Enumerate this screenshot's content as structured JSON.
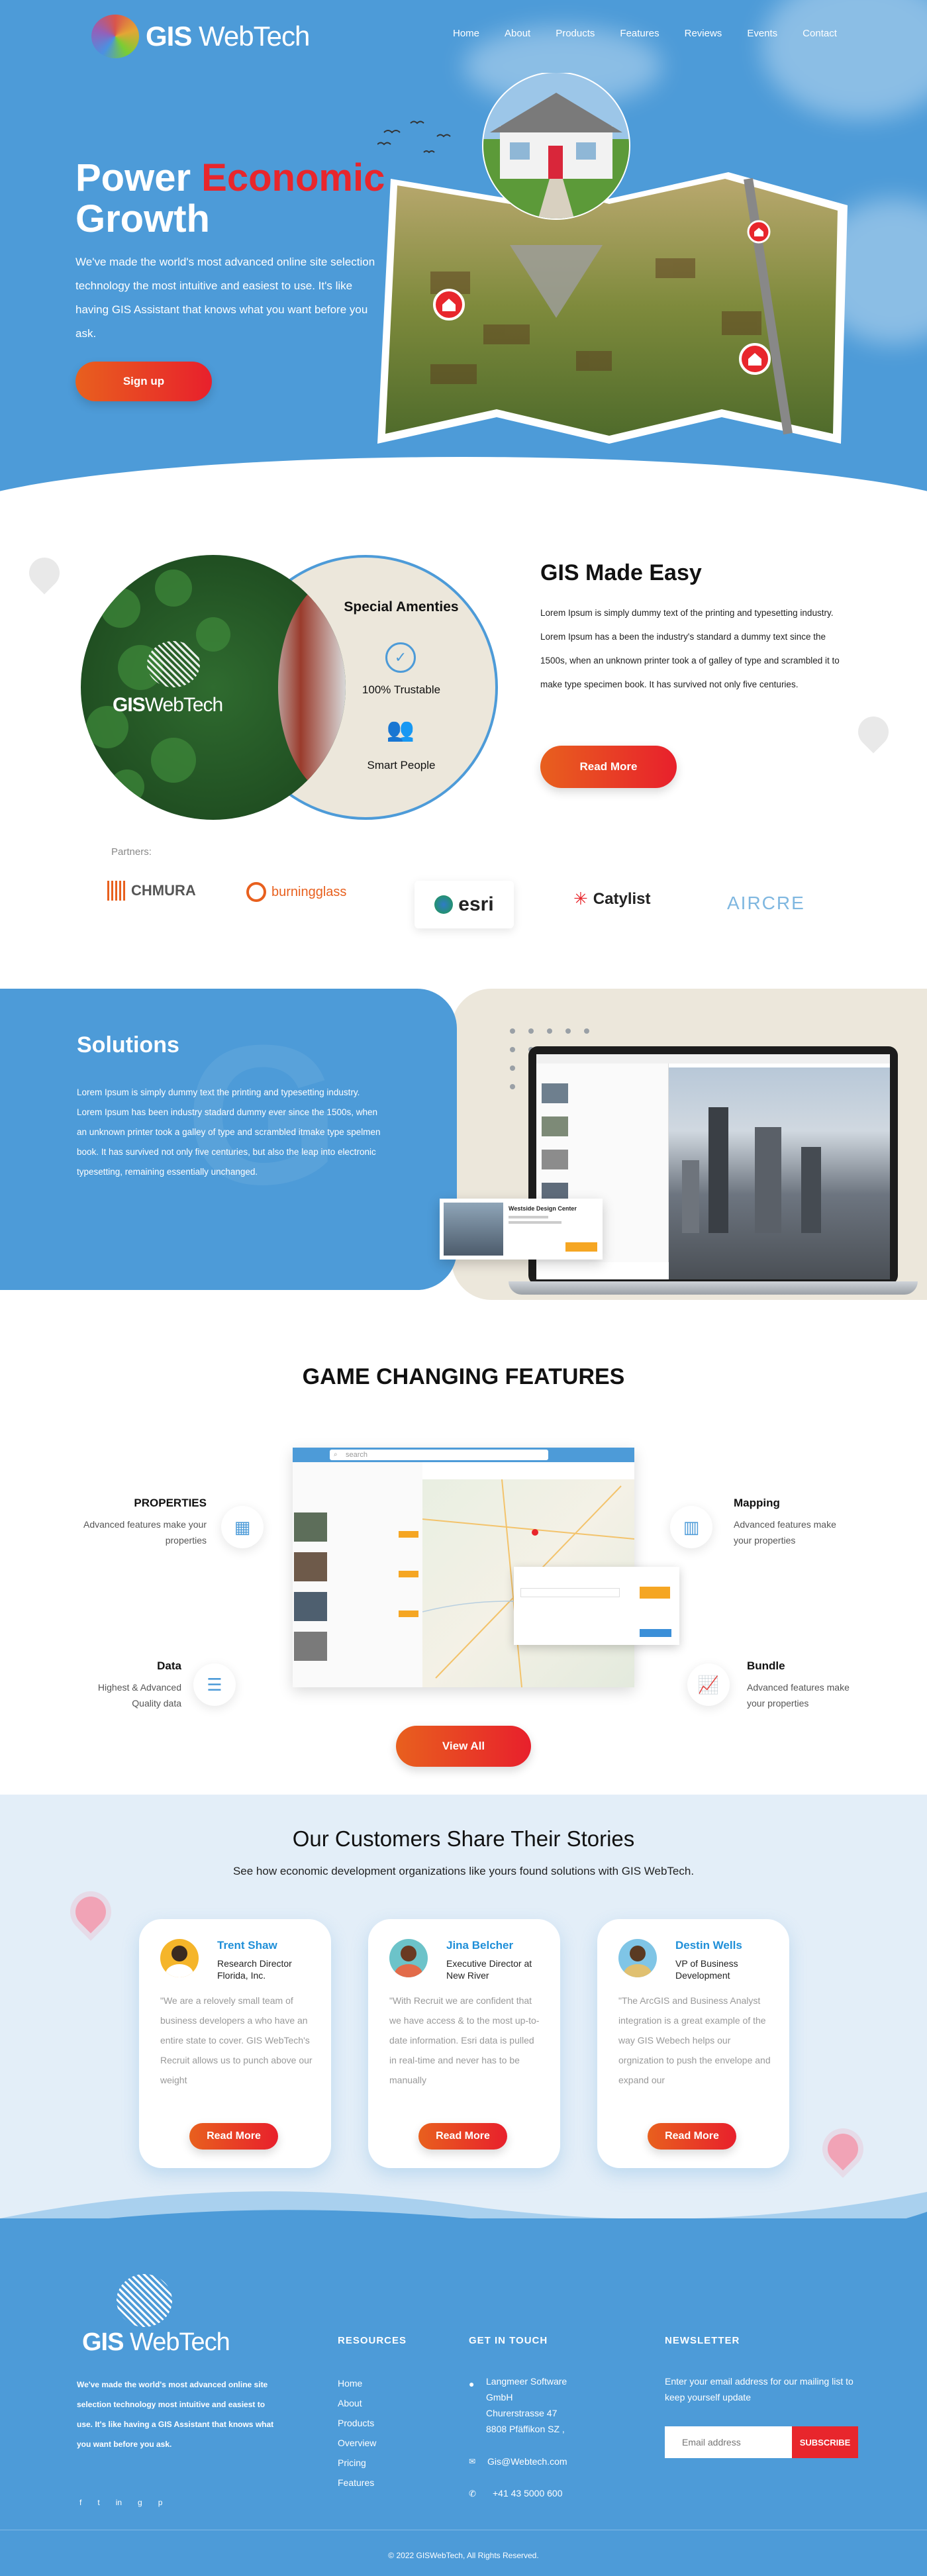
{
  "brand": {
    "name_bold": "GIS",
    "name_light": " WebTech"
  },
  "nav": [
    "Home",
    "About",
    "Products",
    "Features",
    "Reviews",
    "Events",
    "Contact"
  ],
  "hero": {
    "title_1": "Power ",
    "title_red": "Economic",
    "title_2": "Growth",
    "text": "We've made the world's most advanced online site selection technology the most intuitive and easiest to use. It's like having GIS Assistant that knows what you want before you ask.",
    "cta": "Sign up"
  },
  "venn": {
    "right_title": "Special Amenties",
    "item_1": "100% Trustable",
    "item_2": "Smart People",
    "left_label_bold": "GIS",
    "left_label_light": "WebTech"
  },
  "easy": {
    "title": "GIS Made Easy",
    "text": "Lorem Ipsum is simply dummy text of the printing and typesetting industry. Lorem Ipsum has a been the  industry's standard a dummy text  since the 1500s, when an unknown printer took a of galley of type and scrambled it to make type specimen book. It has survived not only five centuries.",
    "cta": "Read More"
  },
  "partners": {
    "label": "Partners:",
    "items": [
      "CHMURA",
      "burningglass",
      "esri",
      "Catylist",
      "AIRCRE"
    ]
  },
  "solutions": {
    "title": "Solutions",
    "text": "Lorem Ipsum is simply dummy text  the printing and typesetting industry. Lorem Ipsum has been industry stadard  dummy ever since the 1500s, when an unknown printer took a galley of type and scrambled itmake type spelmen book. It has survived not only five centuries, but also the leap into electronic typesetting, remaining essentially unchanged.",
    "card_title": "Westside Design Center"
  },
  "features": {
    "title": "GAME CHANGING FEATURES",
    "search_placeholder": "search",
    "items": [
      {
        "title": "PROPERTIES",
        "text": "Advanced features make your properties"
      },
      {
        "title": "Mapping",
        "text": "Advanced features make your properties"
      },
      {
        "title": "Data",
        "text": "Highest & Advanced Quality data"
      },
      {
        "title": "Bundle",
        "text": "Advanced features make your properties"
      }
    ],
    "cta": "View All"
  },
  "testimonials": {
    "title": "Our Customers Share Their Stories",
    "subtitle": "See how economic development organizations like yours found solutions with GIS WebTech.",
    "cards": [
      {
        "name": "Trent Shaw",
        "role": "Research Director Florida, Inc.",
        "quote": "\"We are a relovely small team of business developers a who have an entire state to cover. GIS WebTech's Recruit allows us to punch above our weight",
        "cta": "Read More",
        "avatar_bg": "#f5b52a"
      },
      {
        "name": "Jina Belcher",
        "role": "Executive Director at New River",
        "quote": "\"With Recruit we are confident that we have access  & to the most up-to-date information. Esri data is pulled in real-time and never has to be manually",
        "cta": "Read More",
        "avatar_bg": "#6cc3c9"
      },
      {
        "name": "Destin Wells",
        "role": "VP of Business Development",
        "quote": "\"The ArcGIS and Business Analyst integration is a great example of the way GIS Webech helps our orgnization to push the envelope and expand our",
        "cta": "Read More",
        "avatar_bg": "#7fc5e6"
      }
    ]
  },
  "footer": {
    "about": "We've made the world's most advanced online site selection technology most intuitive and easiest to use. It's like having a GIS Assistant that knows what you want before you ask.",
    "resources_title": "RESOURCES",
    "resources": [
      "Home",
      "About",
      "Products",
      "Overview",
      "Pricing",
      "Features"
    ],
    "contact_title": "GET IN TOUCH",
    "address": [
      "Langmeer Software",
      "GmbH",
      "Churerstrasse 47",
      "8808 Pfäffikon SZ ,"
    ],
    "email": "Gis@Webtech.com",
    "phone": "+41 43 5000 600",
    "newsletter_title": "NEWSLETTER",
    "newsletter_text": "Enter your email address for our mailing list to keep yourself update",
    "email_placeholder": "Email address",
    "subscribe": "SUBSCRIBE",
    "social": [
      "f",
      "t",
      "in",
      "g",
      "p"
    ],
    "copyright": "© 2022 GISWebTech, All Rights Reserved."
  },
  "colors": {
    "primary": "#4d9bd8",
    "accent": "#e8262c",
    "beige": "#ece7db"
  }
}
